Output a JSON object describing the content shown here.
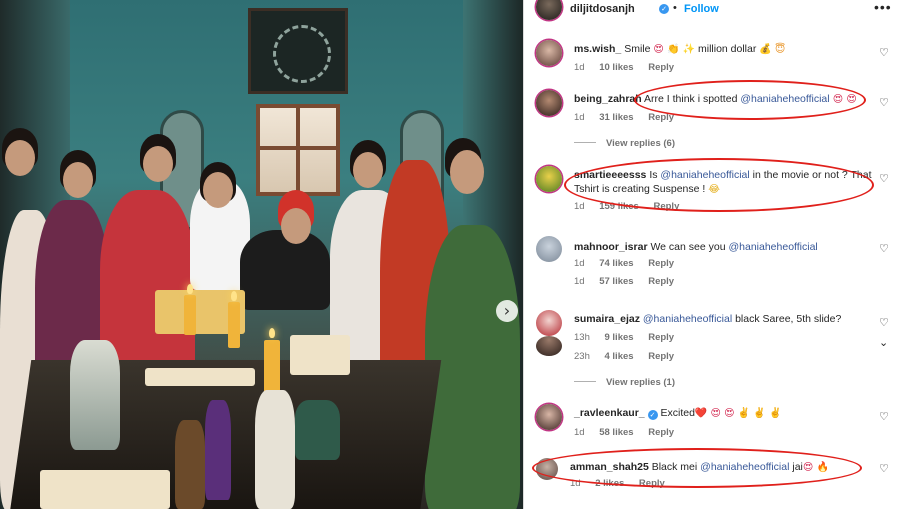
{
  "header": {
    "username": "diljitdosanjh",
    "separator": "•",
    "follow_label": "Follow",
    "more_label": "•••",
    "verified_mark": "✓"
  },
  "photo": {
    "next_arrow": "›"
  },
  "comments": [
    {
      "username": "ms.wish_",
      "text_parts": [
        "Smile "
      ],
      "emoji": "😍 👏 ✨",
      "text_after": " million dollar ",
      "emoji_after": "💰 😇",
      "time": "1d",
      "likes": "10 likes",
      "reply": "Reply"
    },
    {
      "username": "being_zahrah",
      "text": "Arre I think i spotted ",
      "mention": "@haniaheheofficial",
      "emoji": " 😍 😍",
      "time": "1d",
      "likes": "31 likes",
      "reply": "Reply",
      "view_replies": "View replies (6)"
    },
    {
      "username": "smartieeeesss",
      "text": "Is ",
      "mention": "@haniaheheofficial",
      "text_after": " in the movie or not ? That Tshirt is creating Suspense ! ",
      "emoji": "😂",
      "time": "1d",
      "likes": "159 likes",
      "reply": "Reply"
    },
    {
      "username": "mahnoor_israr",
      "text": "We can see you ",
      "mention": "@haniaheheofficial",
      "time": "1d",
      "likes": "74 likes",
      "reply": "Reply"
    },
    {
      "partial_meta": true,
      "time": "1d",
      "likes": "57 likes",
      "reply": "Reply"
    },
    {
      "username": "sumaira_ejaz",
      "mention": "@haniaheheofficial",
      "text_after": " black Saree, 5th slide?",
      "time": "13h",
      "likes": "9 likes",
      "reply": "Reply"
    },
    {
      "partial_meta": true,
      "time": "23h",
      "likes": "4 likes",
      "reply": "Reply",
      "view_replies": "View replies (1)"
    },
    {
      "username": "_ravleenkaur_",
      "verified_mark": "✓",
      "text": "Excited",
      "emoji": "❤️ 😍 😍 ✌️ ✌️ ✌️",
      "time": "1d",
      "likes": "58 likes",
      "reply": "Reply"
    },
    {
      "username": "amman_shah25",
      "text": "Black mei ",
      "mention": "@haniaheheofficial",
      "text_after": " jai",
      "emoji": "😍 🔥",
      "time": "1d",
      "likes": "2 likes",
      "reply": "Reply"
    }
  ],
  "icons": {
    "heart": "♡",
    "chevron": "⌄"
  },
  "colors": {
    "link": "#0095f6",
    "mention": "#385898",
    "annotation": "#e0201b",
    "story_ring": "#c13584"
  }
}
